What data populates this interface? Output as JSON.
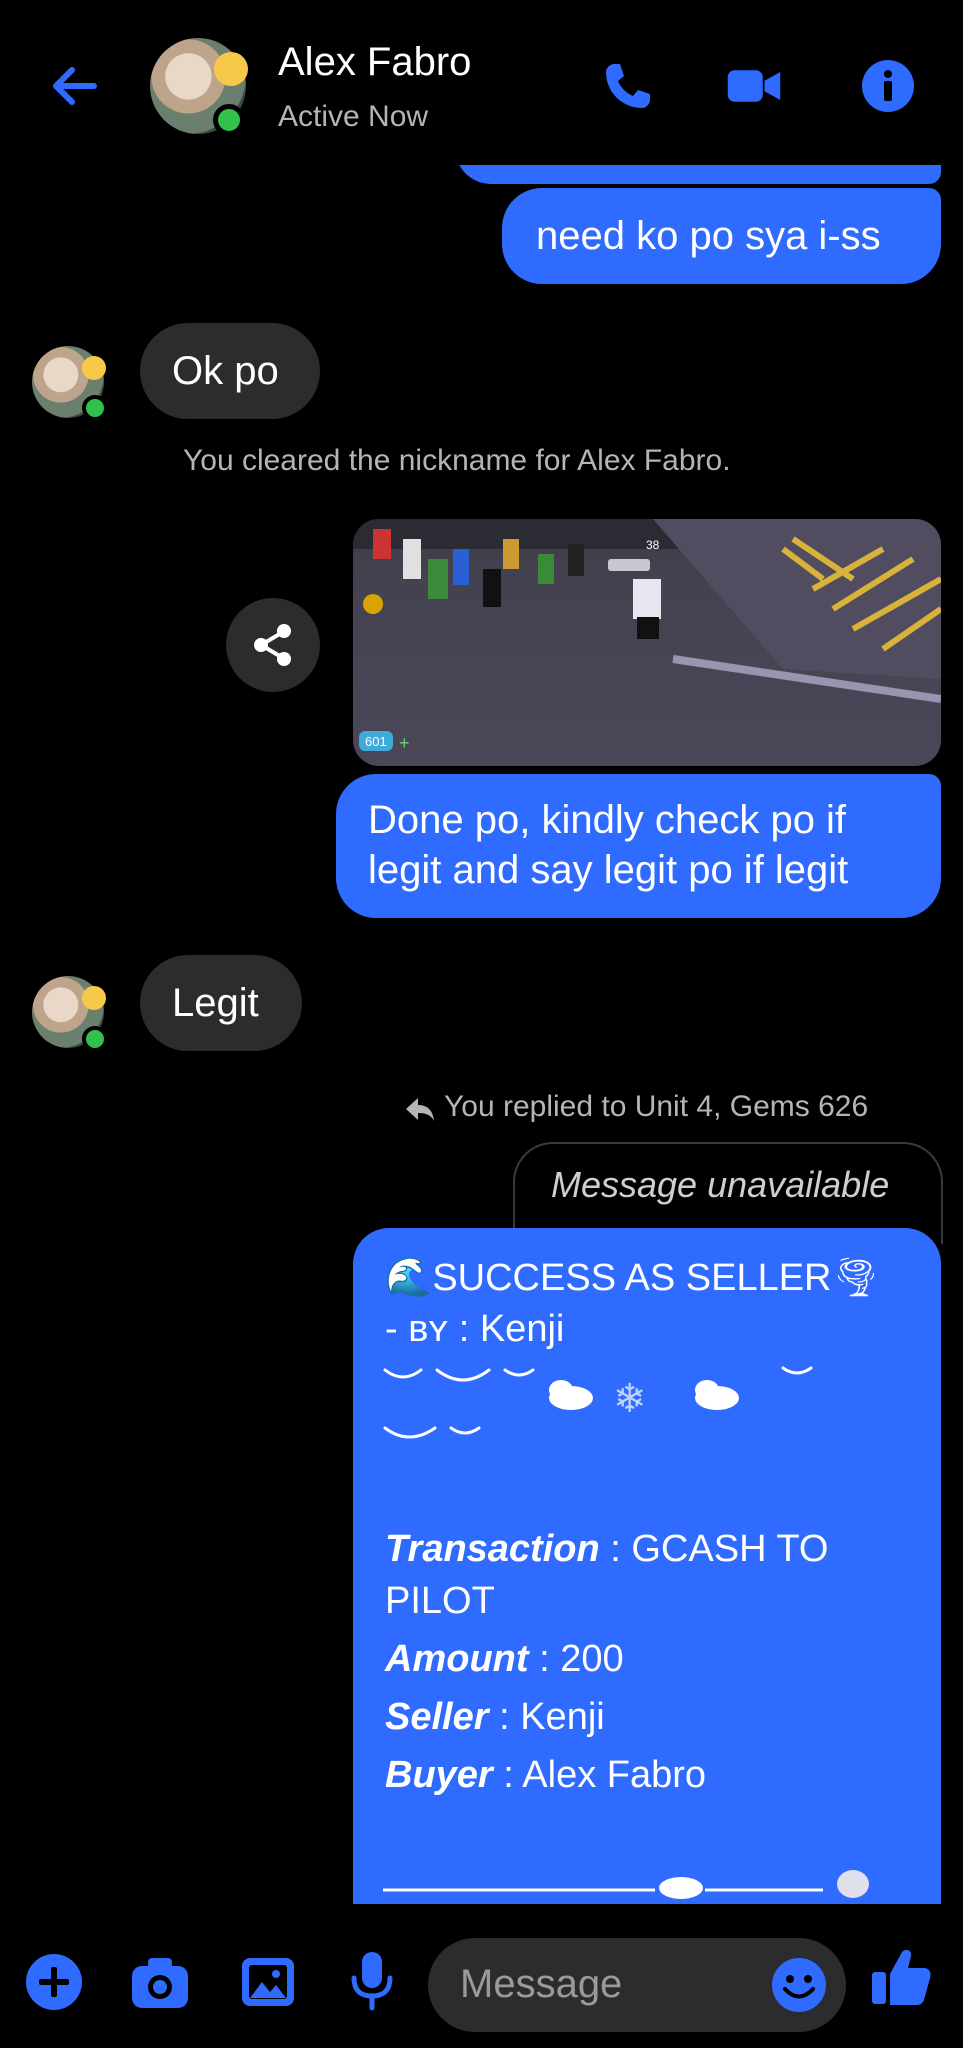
{
  "header": {
    "name": "Alex Fabro",
    "status": "Active Now"
  },
  "messages": {
    "out_1": "need ko po sya i-ss",
    "in_1": "Ok po",
    "system_1": "You cleared the nickname for Alex Fabro.",
    "out_2_line1": "Done po, kindly check po if",
    "out_2_line2": "legit and say legit po if legit",
    "in_2": "Legit",
    "reply_note": "You replied to Unit 4, Gems 626",
    "reply_quote": "Message unavailable"
  },
  "game_image": {
    "counter": "601",
    "badge": "38"
  },
  "card": {
    "title": "SUCCESS AS SELLER",
    "by_prefix": "- ʙʏ",
    "by_name": ": Kenji",
    "transaction_label": "Transaction",
    "transaction_value": ": GCASH TO",
    "transaction_value_2": "PILOT",
    "amount_label": "Amount",
    "amount_value": ": 200",
    "seller_label": "Seller",
    "seller_value": ": Kenji",
    "buyer_label": "Buyer",
    "buyer_value": ": Alex Fabro"
  },
  "composer": {
    "placeholder": "Message"
  },
  "icons": {
    "accent": "#2f6bff",
    "online": "#31c24d"
  }
}
